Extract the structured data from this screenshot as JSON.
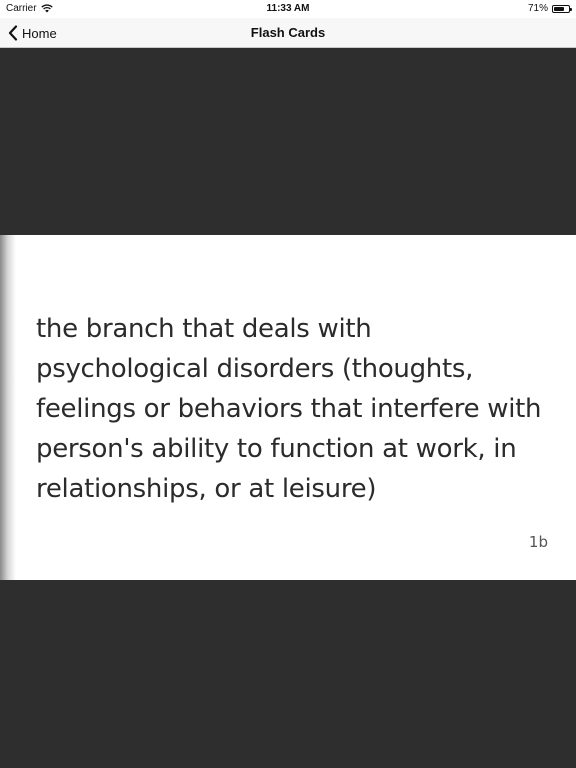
{
  "status_bar": {
    "carrier": "Carrier",
    "time": "11:33 AM",
    "battery_text": "71%",
    "battery_level": 0.71,
    "wifi_icon": "wifi-icon",
    "battery_icon": "battery-icon"
  },
  "nav": {
    "back_label": "Home",
    "back_icon": "chevron-left-icon",
    "title": "Flash Cards"
  },
  "card": {
    "text": "the branch that deals with psychological disorders (thoughts, feelings or behaviors that interfere with person's ability to function at work, in relationships, or at leisure)",
    "id": "1b"
  },
  "colors": {
    "background": "#2e2e2e",
    "card": "#ffffff",
    "nav_bar": "#f7f7f7",
    "text": "#2b2b2b"
  }
}
